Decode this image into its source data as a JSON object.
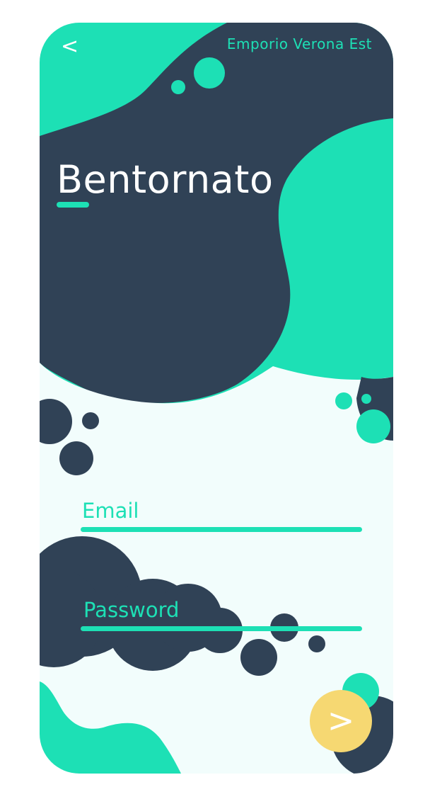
{
  "header": {
    "back_symbol": "<",
    "store_name": "Emporio Verona Est"
  },
  "hero": {
    "title": "Bentornato"
  },
  "form": {
    "email_label": "Email",
    "password_label": "Password",
    "submit_symbol": ">"
  },
  "colors": {
    "navy": "#304256",
    "mint": "#1de0b5",
    "background": "#f2fdfc",
    "button": "#f6d872"
  }
}
